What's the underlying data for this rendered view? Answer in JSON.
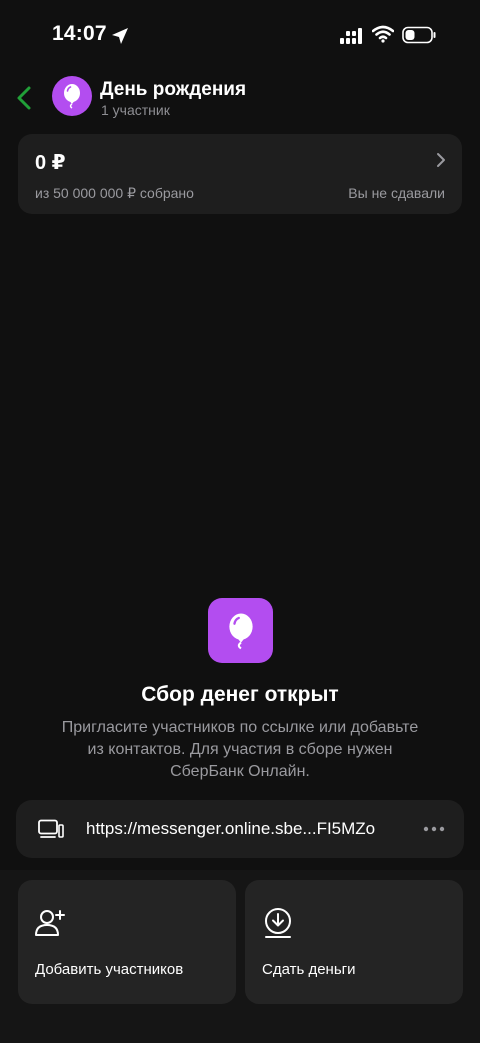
{
  "status_bar": {
    "time": "14:07"
  },
  "header": {
    "title": "День рождения",
    "subtitle": "1 участник"
  },
  "summary": {
    "amount": "0 ₽",
    "goal": "из 50 000 000 ₽ собрано",
    "status": "Вы не сдавали"
  },
  "empty_state": {
    "title": "Сбор денег открыт",
    "description": "Пригласите участников по ссылке или добавьте из контактов. Для участия в сборе нужен СберБанк Онлайн."
  },
  "invite_link": {
    "url": "https://messenger.online.sbe...FI5MZo"
  },
  "actions": {
    "add_participants": "Добавить участников",
    "contribute": "Сдать деньги"
  },
  "icons": {
    "back": "chevron-left-icon",
    "avatar": "balloon-icon",
    "link": "devices-icon",
    "more": "more-dots-icon",
    "add_participants": "add-user-icon",
    "contribute": "download-circle-icon"
  },
  "colors": {
    "accent_green": "#21a038",
    "accent_purple": "#b34df0",
    "background": "#101010",
    "card": "#1e1e1e"
  }
}
